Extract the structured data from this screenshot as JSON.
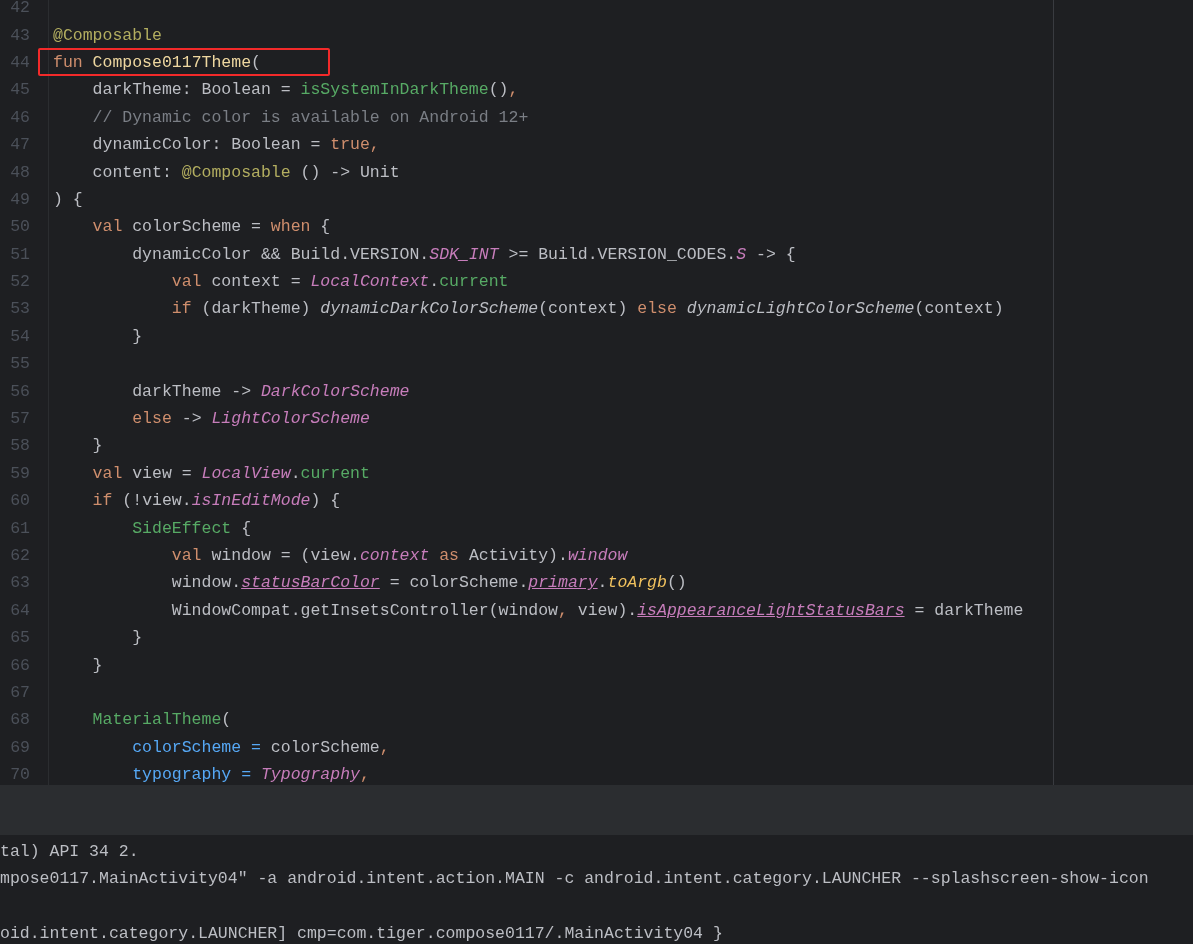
{
  "editor": {
    "lines": [
      {
        "number": "42",
        "boxed": false
      },
      {
        "number": "43",
        "boxed": false,
        "tokens": [
          {
            "kind": "annotation",
            "text": "@Composable"
          }
        ]
      },
      {
        "number": "44",
        "boxed": true,
        "tokens": [
          {
            "kind": "keyword",
            "text": "fun "
          },
          {
            "kind": "declaration",
            "text": "Compose0117Theme"
          },
          {
            "kind": "plain",
            "text": "("
          }
        ]
      },
      {
        "number": "45",
        "boxed": false,
        "tokens": [
          {
            "kind": "plain",
            "text": "    darkTheme: Boolean = "
          },
          {
            "kind": "call",
            "text": "isSystemInDarkTheme"
          },
          {
            "kind": "plain",
            "text": "()"
          },
          {
            "kind": "keyword",
            "text": ","
          }
        ]
      },
      {
        "number": "46",
        "boxed": false,
        "tokens": [
          {
            "kind": "comment",
            "text": "    // Dynamic color is available on Android 12+"
          }
        ]
      },
      {
        "number": "47",
        "boxed": false,
        "tokens": [
          {
            "kind": "plain",
            "text": "    dynamicColor: Boolean = "
          },
          {
            "kind": "keyword",
            "text": "true,"
          }
        ]
      },
      {
        "number": "48",
        "boxed": false,
        "tokens": [
          {
            "kind": "plain",
            "text": "    content: "
          },
          {
            "kind": "annotation",
            "text": "@Composable"
          },
          {
            "kind": "plain",
            "text": " () -> Unit"
          }
        ]
      },
      {
        "number": "49",
        "boxed": false,
        "tokens": [
          {
            "kind": "plain",
            "text": ") {"
          }
        ]
      },
      {
        "number": "50",
        "boxed": false,
        "tokens": [
          {
            "kind": "keyword",
            "text": "    val"
          },
          {
            "kind": "plain",
            "text": " colorScheme = "
          },
          {
            "kind": "keyword",
            "text": "when"
          },
          {
            "kind": "plain",
            "text": " {"
          }
        ]
      },
      {
        "number": "51",
        "boxed": false,
        "tokens": [
          {
            "kind": "plain",
            "text": "        dynamicColor && Build.VERSION."
          },
          {
            "kind": "static",
            "text": "SDK_INT"
          },
          {
            "kind": "plain",
            "text": " >= Build.VERSION_CODES."
          },
          {
            "kind": "static",
            "text": "S"
          },
          {
            "kind": "plain",
            "text": " -> {"
          }
        ]
      },
      {
        "number": "52",
        "boxed": false,
        "tokens": [
          {
            "kind": "keyword",
            "text": "            val"
          },
          {
            "kind": "plain",
            "text": " context = "
          },
          {
            "kind": "static",
            "text": "LocalContext"
          },
          {
            "kind": "plain",
            "text": "."
          },
          {
            "kind": "call",
            "text": "current"
          }
        ]
      },
      {
        "number": "53",
        "boxed": false,
        "tokens": [
          {
            "kind": "keyword",
            "text": "            if"
          },
          {
            "kind": "plain",
            "text": " (darkTheme) "
          },
          {
            "kind": "italic",
            "text": "dynamicDarkColorScheme"
          },
          {
            "kind": "plain",
            "text": "(context) "
          },
          {
            "kind": "keyword",
            "text": "else"
          },
          {
            "kind": "italic",
            "text": " dynamicLightColorScheme"
          },
          {
            "kind": "plain",
            "text": "(context)"
          }
        ]
      },
      {
        "number": "54",
        "boxed": false,
        "tokens": [
          {
            "kind": "plain",
            "text": "        }"
          }
        ]
      },
      {
        "number": "55",
        "boxed": false
      },
      {
        "number": "56",
        "boxed": false,
        "tokens": [
          {
            "kind": "plain",
            "text": "        darkTheme -> "
          },
          {
            "kind": "static",
            "text": "DarkColorScheme"
          }
        ]
      },
      {
        "number": "57",
        "boxed": false,
        "tokens": [
          {
            "kind": "keyword",
            "text": "        else"
          },
          {
            "kind": "plain",
            "text": " -> "
          },
          {
            "kind": "static",
            "text": "LightColorScheme"
          }
        ]
      },
      {
        "number": "58",
        "boxed": false,
        "tokens": [
          {
            "kind": "plain",
            "text": "    }"
          }
        ]
      },
      {
        "number": "59",
        "boxed": false,
        "tokens": [
          {
            "kind": "keyword",
            "text": "    val"
          },
          {
            "kind": "plain",
            "text": " view = "
          },
          {
            "kind": "static",
            "text": "LocalView"
          },
          {
            "kind": "plain",
            "text": "."
          },
          {
            "kind": "call",
            "text": "current"
          }
        ]
      },
      {
        "number": "60",
        "boxed": false,
        "tokens": [
          {
            "kind": "keyword",
            "text": "    if"
          },
          {
            "kind": "plain",
            "text": " (!view."
          },
          {
            "kind": "static",
            "text": "isInEditMode"
          },
          {
            "kind": "plain",
            "text": ") {"
          }
        ]
      },
      {
        "number": "61",
        "boxed": false,
        "tokens": [
          {
            "kind": "call",
            "text": "        SideEffect"
          },
          {
            "kind": "plain",
            "text": " {"
          }
        ]
      },
      {
        "number": "62",
        "boxed": false,
        "tokens": [
          {
            "kind": "keyword",
            "text": "            val"
          },
          {
            "kind": "plain",
            "text": " window = (view."
          },
          {
            "kind": "static",
            "text": "context"
          },
          {
            "kind": "keyword",
            "text": " as"
          },
          {
            "kind": "plain",
            "text": " Activity)."
          },
          {
            "kind": "static",
            "text": "window"
          }
        ]
      },
      {
        "number": "63",
        "boxed": false,
        "tokens": [
          {
            "kind": "plain",
            "text": "            window."
          },
          {
            "kind": "synthetic",
            "text": "statusBarColor"
          },
          {
            "kind": "plain",
            "text": " = colorScheme."
          },
          {
            "kind": "synthetic",
            "text": "primary"
          },
          {
            "kind": "plain",
            "text": "."
          },
          {
            "kind": "extension",
            "text": "toArgb"
          },
          {
            "kind": "plain",
            "text": "()"
          }
        ]
      },
      {
        "number": "64",
        "boxed": false,
        "tokens": [
          {
            "kind": "plain",
            "text": "            WindowCompat.getInsetsController(window"
          },
          {
            "kind": "keyword",
            "text": ","
          },
          {
            "kind": "plain",
            "text": " view)."
          },
          {
            "kind": "synthetic",
            "text": "isAppearanceLightStatusBars"
          },
          {
            "kind": "plain",
            "text": " = darkTheme"
          }
        ]
      },
      {
        "number": "65",
        "boxed": false,
        "tokens": [
          {
            "kind": "plain",
            "text": "        }"
          }
        ]
      },
      {
        "number": "66",
        "boxed": false,
        "tokens": [
          {
            "kind": "plain",
            "text": "    }"
          }
        ]
      },
      {
        "number": "67",
        "boxed": false
      },
      {
        "number": "68",
        "boxed": false,
        "tokens": [
          {
            "kind": "call",
            "text": "    MaterialTheme"
          },
          {
            "kind": "plain",
            "text": "("
          }
        ]
      },
      {
        "number": "69",
        "boxed": false,
        "tokens": [
          {
            "kind": "named-arg",
            "text": "        colorScheme ="
          },
          {
            "kind": "plain",
            "text": " colorScheme"
          },
          {
            "kind": "keyword",
            "text": ","
          }
        ]
      },
      {
        "number": "70",
        "boxed": false,
        "tokens": [
          {
            "kind": "named-arg",
            "text": "        typography ="
          },
          {
            "kind": "static",
            "text": " Typography"
          },
          {
            "kind": "keyword",
            "text": ","
          }
        ]
      }
    ]
  },
  "console": {
    "lines": [
      "tal) API 34 2.",
      "mpose0117.MainActivity04\" -a android.intent.action.MAIN -c android.intent.category.LAUNCHER --splashscreen-show-icon",
      "oid.intent.category.LAUNCHER] cmp=com.tiger.compose0117/.MainActivity04 }"
    ]
  }
}
